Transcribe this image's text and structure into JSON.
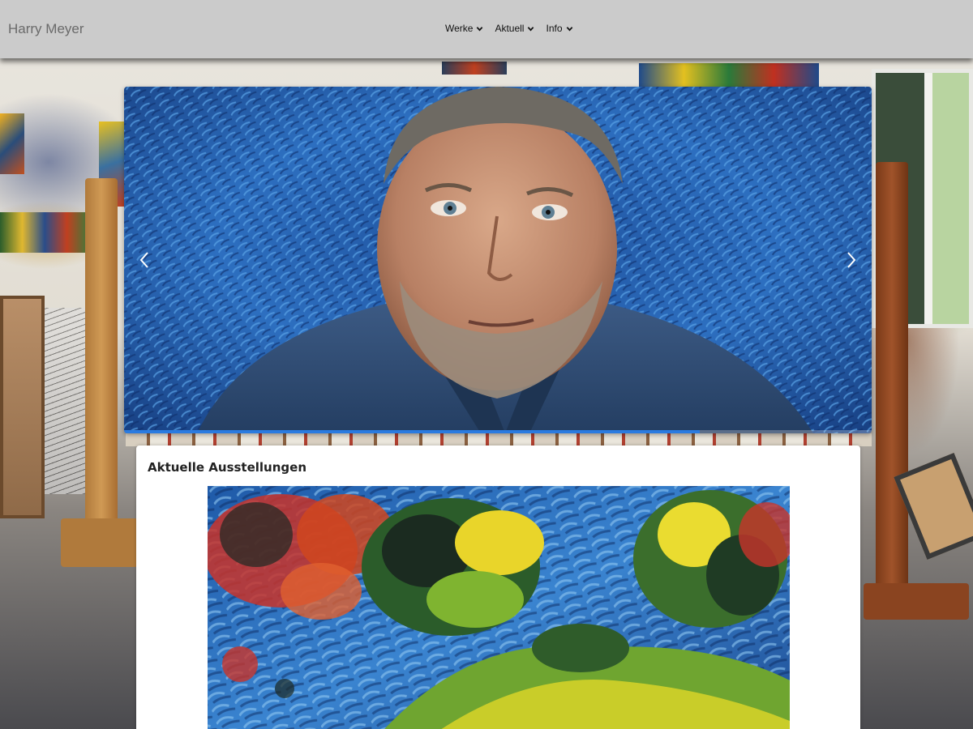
{
  "header": {
    "brand": "Harry Meyer",
    "nav": [
      {
        "label": "Werke"
      },
      {
        "label": "Aktuell"
      },
      {
        "label": "Info"
      }
    ]
  },
  "carousel": {
    "progress": 0.77,
    "accent_color": "#2a7be0"
  },
  "exhibitions": {
    "title": "Aktuelle Ausstellungen"
  },
  "icons": {
    "nav_dropdown": "chevron-down-icon",
    "carousel_prev": "chevron-left-icon",
    "carousel_next": "chevron-right-icon"
  }
}
